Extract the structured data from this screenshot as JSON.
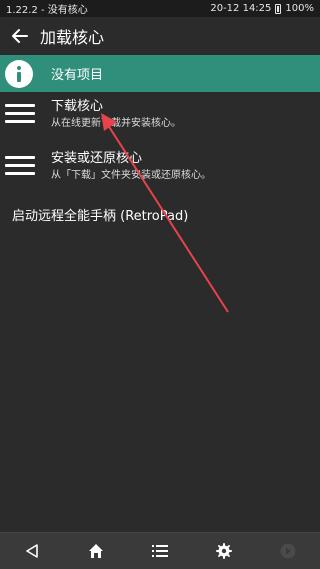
{
  "status": {
    "left_text": "1.22.2 - 没有核心",
    "right_text": "20-12 14:25",
    "battery": "100%"
  },
  "header": {
    "title": "加载核心",
    "back_icon": "arrow-left-icon"
  },
  "info": {
    "label": "没有项目",
    "icon": "info-icon",
    "color": "#2f8f7b"
  },
  "items": [
    {
      "title": "下载核心",
      "subtitle": "从在线更新下载并安装核心。",
      "icon": "hamburger-icon"
    },
    {
      "title": "安装或还原核心",
      "subtitle": "从「下载」文件夹安装或还原核心。",
      "icon": "hamburger-icon"
    }
  ],
  "remote": {
    "label": "启动远程全能手柄 (RetroPad)"
  },
  "navbar": {
    "icons": [
      "back-triangle-icon",
      "home-icon",
      "list-icon",
      "gear-icon",
      "play-circle-icon"
    ]
  },
  "annotation": {
    "color": "#e8434a"
  }
}
